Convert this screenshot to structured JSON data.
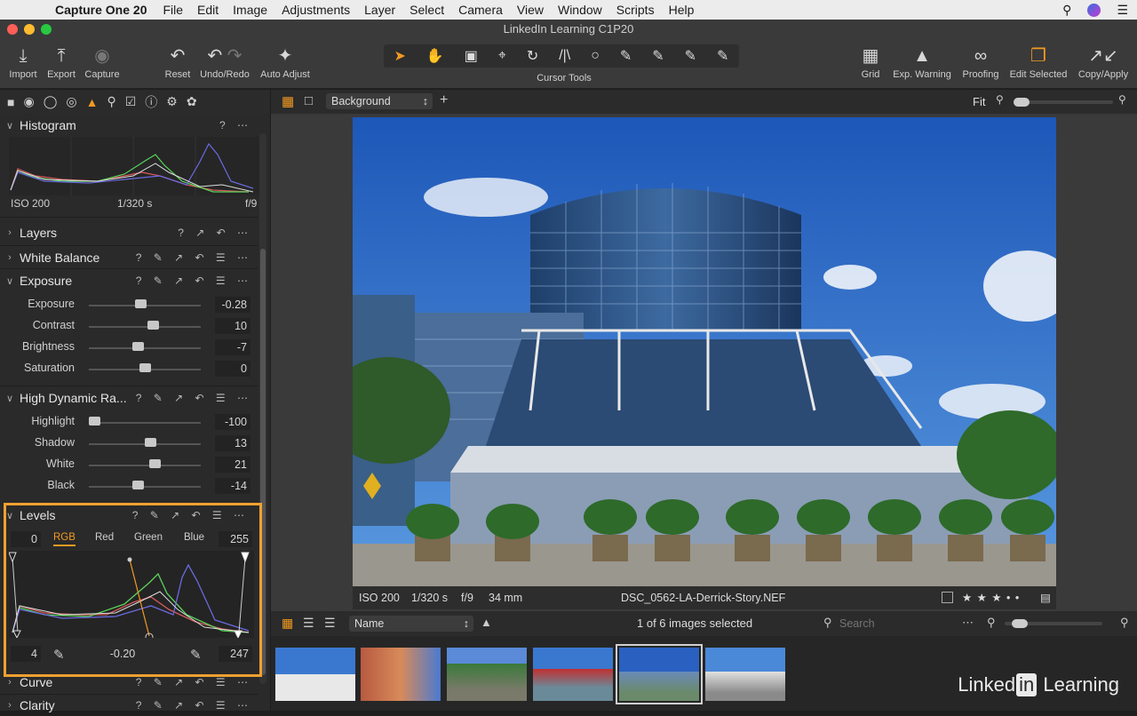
{
  "menubar": {
    "app": "Capture One 20",
    "items": [
      "File",
      "Edit",
      "Image",
      "Adjustments",
      "Layer",
      "Select",
      "Camera",
      "View",
      "Window",
      "Scripts",
      "Help"
    ]
  },
  "window": {
    "title": "LinkedIn Learning C1P20"
  },
  "toolbar": {
    "import": "Import",
    "export": "Export",
    "capture": "Capture",
    "reset": "Reset",
    "undo_redo": "Undo/Redo",
    "auto_adjust": "Auto Adjust",
    "cursor_tools": "Cursor Tools",
    "grid": "Grid",
    "exp_warning": "Exp. Warning",
    "proofing": "Proofing",
    "edit_selected": "Edit Selected",
    "copy_apply": "Copy/Apply"
  },
  "histogram": {
    "title": "Histogram",
    "iso": "ISO 200",
    "shutter": "1/320 s",
    "aperture": "f/9"
  },
  "tools": {
    "layers": "Layers",
    "white_balance": "White Balance",
    "exposure": "Exposure",
    "hdr": "High Dynamic Ra...",
    "levels": "Levels",
    "curve": "Curve",
    "clarity": "Clarity",
    "help": "?"
  },
  "exposure": [
    {
      "label": "Exposure",
      "value": "-0.28",
      "pos": 0.46
    },
    {
      "label": "Contrast",
      "value": "10",
      "pos": 0.58
    },
    {
      "label": "Brightness",
      "value": "-7",
      "pos": 0.43
    },
    {
      "label": "Saturation",
      "value": "0",
      "pos": 0.5
    }
  ],
  "hdr": [
    {
      "label": "Highlight",
      "value": "-100",
      "pos": 0.0
    },
    {
      "label": "Shadow",
      "value": "13",
      "pos": 0.56
    },
    {
      "label": "White",
      "value": "21",
      "pos": 0.6
    },
    {
      "label": "Black",
      "value": "-14",
      "pos": 0.43
    }
  ],
  "levels": {
    "input_low": "0",
    "input_high": "255",
    "channels": [
      "RGB",
      "Red",
      "Green",
      "Blue"
    ],
    "output_low": "4",
    "midtone": "-0.20",
    "output_high": "247"
  },
  "viewer": {
    "preset": "Background",
    "zoom": "Fit"
  },
  "image_info": {
    "iso": "ISO 200",
    "shutter": "1/320 s",
    "aperture": "f/9",
    "focal": "34 mm",
    "filename": "DSC_0562-LA-Derrick-Story.NEF",
    "rating": "★ ★ ★ • •"
  },
  "browser": {
    "sort": "Name",
    "count": "1 of 6 images selected",
    "search_placeholder": "Search"
  },
  "brand": {
    "linked": "Linked",
    "in": "in",
    "learning": "Learning"
  },
  "colors": {
    "accent": "#f39a21",
    "highlight_box": "#f0a030"
  }
}
